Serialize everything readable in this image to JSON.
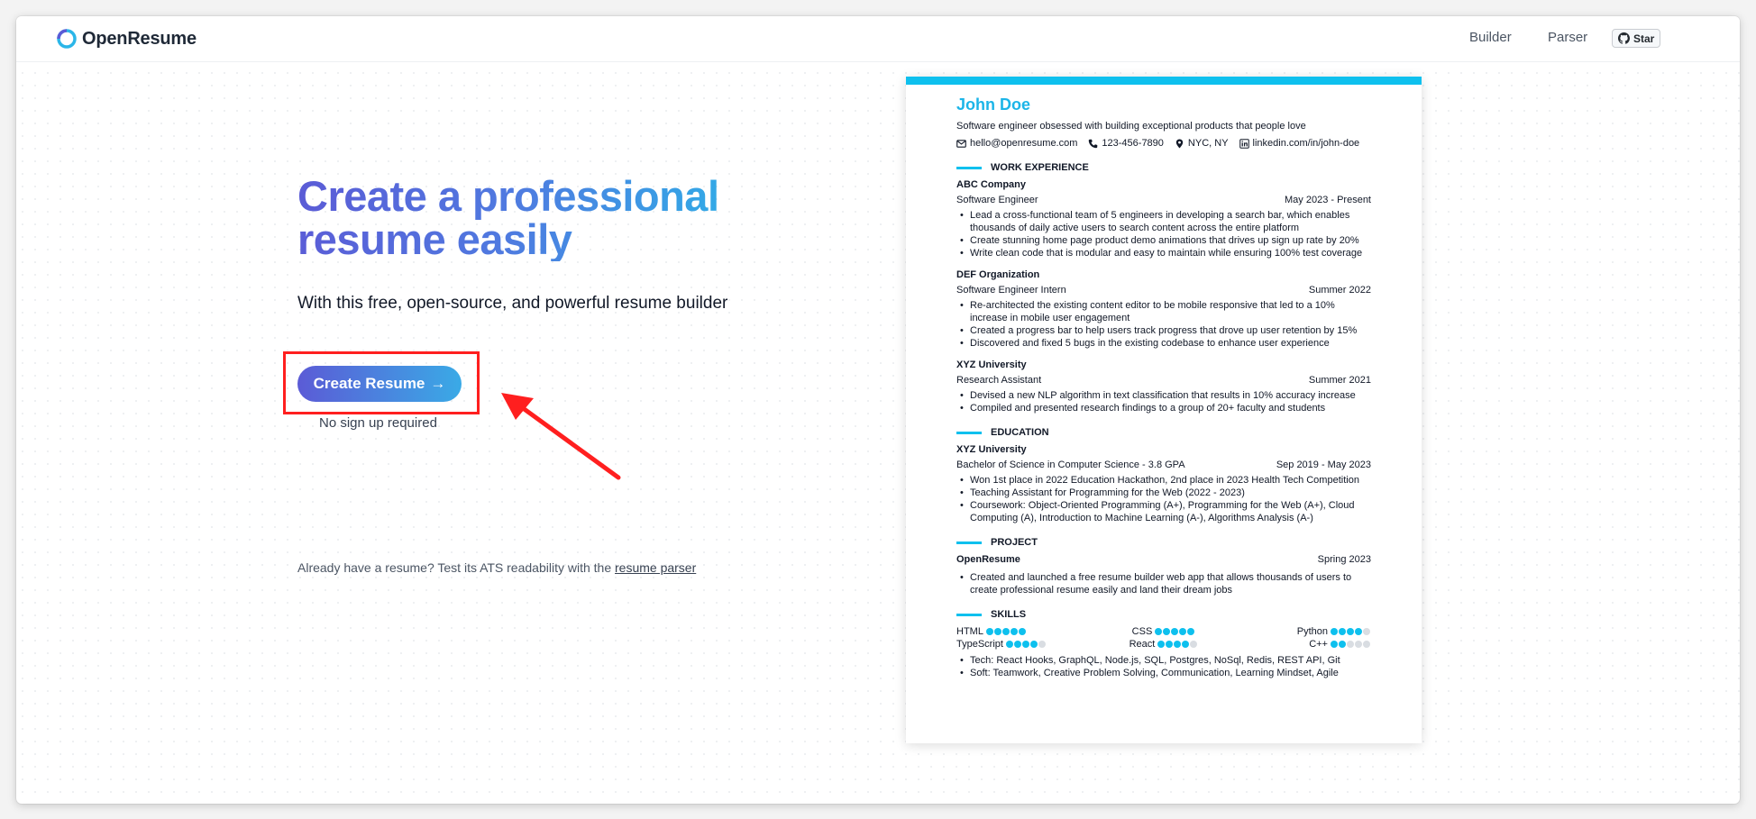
{
  "nav": {
    "logo_text": "OpenResume",
    "builder": "Builder",
    "parser": "Parser",
    "star": "Star"
  },
  "hero": {
    "title": "Create a professional resume easily",
    "subtitle": "With this free, open-source, and powerful resume builder",
    "cta_label": "Create Resume",
    "cta_arrow": "→",
    "no_signup": "No sign up required",
    "already_text": "Already have a resume? Test its ATS readability with the",
    "parser_link": "resume parser"
  },
  "colors": {
    "accent": "#0ec0ee",
    "gradient_start": "#5b5bd6",
    "gradient_end": "#2bb6e8",
    "annotation": "#ff1f1f"
  },
  "resume": {
    "name": "John Doe",
    "summary": "Software engineer obsessed with building exceptional products that people love",
    "contact": {
      "email": "hello@openresume.com",
      "phone": "123-456-7890",
      "location": "NYC, NY",
      "linkedin": "linkedin.com/in/john-doe"
    },
    "work_title": "WORK EXPERIENCE",
    "work": [
      {
        "company": "ABC Company",
        "role": "Software Engineer",
        "date": "May 2023 - Present",
        "bullets": [
          "Lead a cross-functional team of 5 engineers in developing a search bar, which enables thousands of daily active users to search content across the entire platform",
          "Create stunning home page product demo animations that drives up sign up rate by 20%",
          "Write clean code that is modular and easy to maintain while ensuring 100% test coverage"
        ]
      },
      {
        "company": "DEF Organization",
        "role": "Software Engineer Intern",
        "date": "Summer 2022",
        "bullets": [
          "Re-architected the existing content editor to be mobile responsive that led to a 10% increase in mobile user engagement",
          "Created a progress bar to help users track progress that drove up user retention by 15%",
          "Discovered and fixed 5 bugs in the existing codebase to enhance user experience"
        ]
      },
      {
        "company": "XYZ University",
        "role": "Research Assistant",
        "date": "Summer 2021",
        "bullets": [
          "Devised a new NLP algorithm in text classification that results in 10% accuracy increase",
          "Compiled and presented research findings to a group of 20+ faculty and students"
        ]
      }
    ],
    "education_title": "EDUCATION",
    "education": {
      "school": "XYZ University",
      "degree": "Bachelor of Science in Computer Science - 3.8 GPA",
      "date": "Sep 2019 - May 2023",
      "bullets": [
        "Won 1st place in 2022 Education Hackathon, 2nd place in 2023 Health Tech Competition",
        "Teaching Assistant for Programming for the Web (2022 - 2023)",
        "Coursework: Object-Oriented Programming (A+), Programming for the Web (A+), Cloud Computing (A), Introduction to Machine Learning (A-), Algorithms Analysis (A-)"
      ]
    },
    "project_title": "PROJECT",
    "project": {
      "name": "OpenResume",
      "date": "Spring 2023",
      "bullets": [
        "Created and launched a free resume builder web app that allows thousands of users to create professional resume easily and land their dream jobs"
      ]
    },
    "skills_title": "SKILLS",
    "skills": [
      {
        "name": "HTML",
        "rating": 5
      },
      {
        "name": "CSS",
        "rating": 5
      },
      {
        "name": "Python",
        "rating": 4
      },
      {
        "name": "TypeScript",
        "rating": 4
      },
      {
        "name": "React",
        "rating": 4
      },
      {
        "name": "C++",
        "rating": 2
      }
    ],
    "skill_bullets": [
      "Tech: React Hooks, GraphQL, Node.js, SQL, Postgres, NoSql, Redis, REST API, Git",
      "Soft: Teamwork, Creative Problem Solving, Communication, Learning Mindset, Agile"
    ]
  }
}
